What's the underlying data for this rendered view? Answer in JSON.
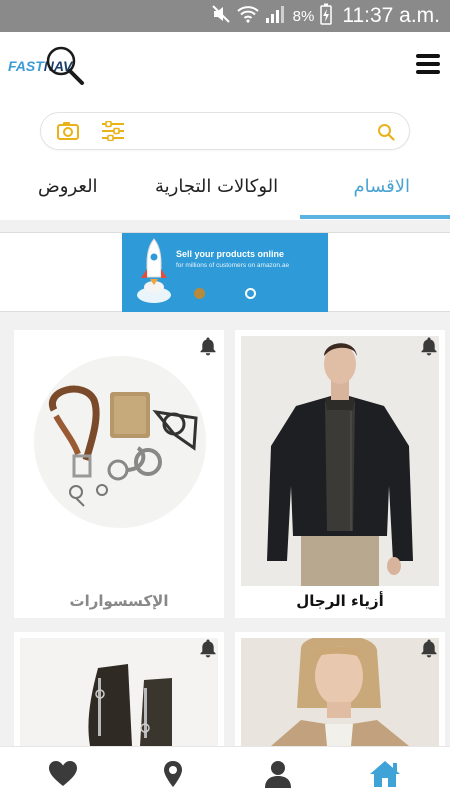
{
  "status_bar": {
    "battery": "8%",
    "time": "11:37 a.m."
  },
  "app": {
    "logo_fast": "FAST",
    "logo_nav": "NAV"
  },
  "tabs": [
    {
      "label": "الاقسام",
      "active": true
    },
    {
      "label": "الوكالات التجارية",
      "active": false
    },
    {
      "label": "العروض",
      "active": false
    }
  ],
  "banner": {
    "headline": "Sell your products online",
    "subline": "for millions of customers on amazon.ae",
    "slide_count": 2,
    "active_slide": 2
  },
  "categories": [
    {
      "label": "أزياء الرجال"
    },
    {
      "label": "الإكسسوارات"
    },
    {
      "label": ""
    },
    {
      "label": ""
    }
  ],
  "bottom_nav": [
    "home-icon",
    "user-icon",
    "location-pin-icon",
    "heart-icon"
  ],
  "colors": {
    "accent": "#4aa3d3",
    "icon_gold": "#e9b21a",
    "banner_blue": "#2e9ad8"
  }
}
